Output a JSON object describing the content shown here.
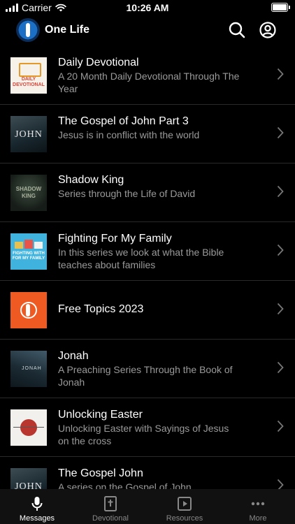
{
  "status": {
    "carrier": "Carrier",
    "time": "10:26 AM"
  },
  "header": {
    "title": "One Life"
  },
  "items": [
    {
      "title": "Daily Devotional",
      "subtitle": "A 20 Month Daily Devotional Through The Year",
      "thumb_text": "DAILY DEVOTIONAL"
    },
    {
      "title": "The Gospel of John Part 3",
      "subtitle": "Jesus is in conflict with the world",
      "thumb_text": "JOHN"
    },
    {
      "title": "Shadow King",
      "subtitle": "Series through the Life of David",
      "thumb_text": "SHADOW KING"
    },
    {
      "title": "Fighting For My Family",
      "subtitle": "In this series we look at what the Bible teaches about families",
      "thumb_text": "FIGHTING WITH FOR MY FAMILY"
    },
    {
      "title": "Free Topics 2023",
      "subtitle": ""
    },
    {
      "title": "Jonah",
      "subtitle": "A Preaching Series Through the Book of Jonah",
      "thumb_text": "JONAH"
    },
    {
      "title": "Unlocking Easter",
      "subtitle": "Unlocking Easter with Sayings of Jesus on the cross"
    },
    {
      "title": "The Gospel John",
      "subtitle": "A series on the Gospel of John",
      "thumb_text": "JOHN"
    }
  ],
  "tabs": [
    {
      "label": "Messages",
      "icon": "microphone-icon"
    },
    {
      "label": "Devotional",
      "icon": "bible-icon"
    },
    {
      "label": "Resources",
      "icon": "play-icon"
    },
    {
      "label": "More",
      "icon": "more-icon"
    }
  ]
}
